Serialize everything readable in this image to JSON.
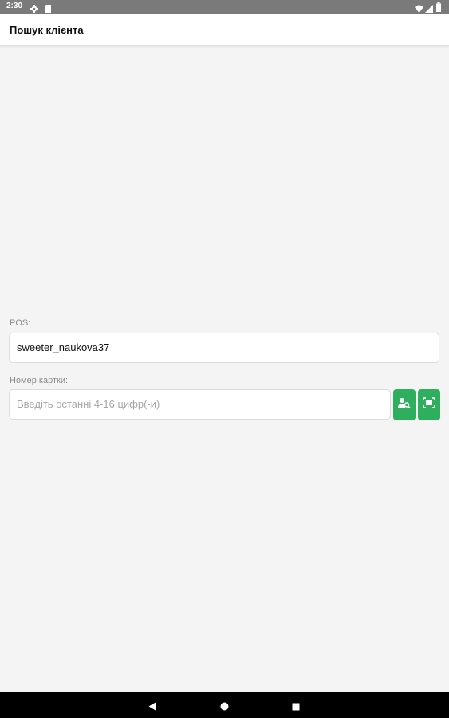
{
  "status_bar": {
    "time": "2:30",
    "icons": [
      "gear-icon",
      "sd-card-icon",
      "wifi-icon",
      "signal-icon",
      "battery-icon"
    ]
  },
  "app_bar": {
    "title": "Пошук клієнта"
  },
  "form": {
    "pos_label": "POS:",
    "pos_value": "sweeter_naukova37",
    "card_label": "Номер картки:",
    "card_placeholder": "Введіть останні 4-16 цифр(-и)",
    "search_button_icon": "person-search-icon",
    "scan_button_icon": "scan-icon"
  },
  "nav_bar": {
    "icons": [
      "back-icon",
      "home-icon",
      "recents-icon"
    ]
  },
  "colors": {
    "accent": "#2eaf5e",
    "background": "#f4f4f4",
    "status_bar": "#7a7a7a",
    "nav_bar": "#000000"
  }
}
